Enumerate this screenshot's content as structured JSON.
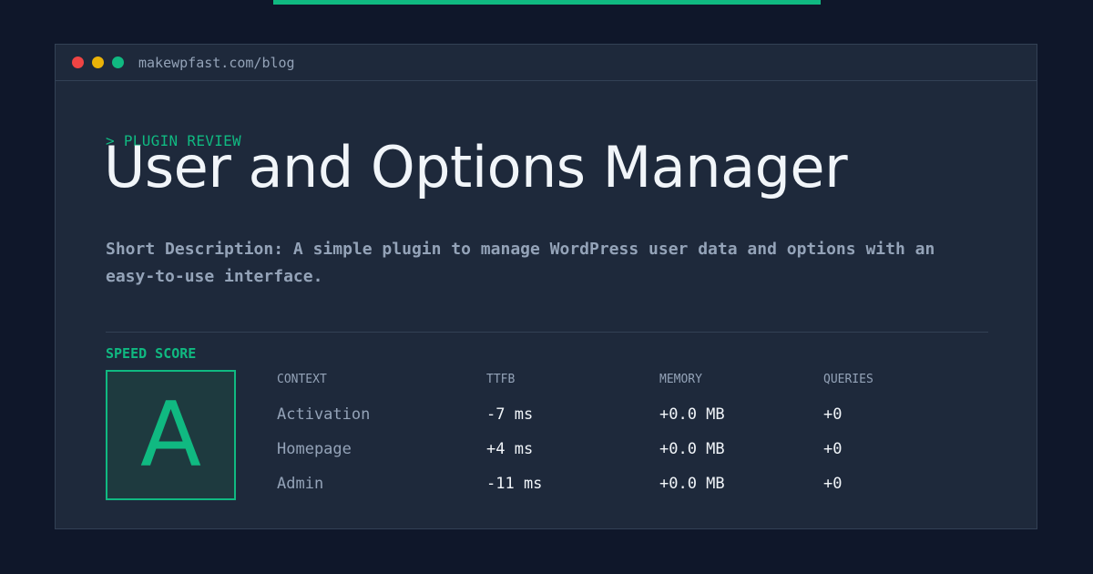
{
  "colors": {
    "accent": "#10b981",
    "background": "#0f172a",
    "window": "#1e293b",
    "muted_text": "#94a3b8",
    "text": "#f1f5f9",
    "dot_red": "#ef4444",
    "dot_yellow": "#eab308",
    "dot_green": "#10b981"
  },
  "window": {
    "url": "makewpfast.com/blog"
  },
  "post": {
    "kicker": "> PLUGIN REVIEW",
    "title": "User and Options Manager",
    "description": "Short Description: A simple plugin to manage WordPress user data and options with an easy-to-use interface."
  },
  "score": {
    "label": "SPEED SCORE",
    "grade": "A"
  },
  "metrics": {
    "headers": [
      "CONTEXT",
      "TTFB",
      "MEMORY",
      "QUERIES"
    ],
    "rows": [
      [
        "Activation",
        "-7 ms",
        "+0.0 MB",
        "+0"
      ],
      [
        "Homepage",
        "+4 ms",
        "+0.0 MB",
        "+0"
      ],
      [
        "Admin",
        "-11 ms",
        "+0.0 MB",
        "+0"
      ]
    ]
  }
}
